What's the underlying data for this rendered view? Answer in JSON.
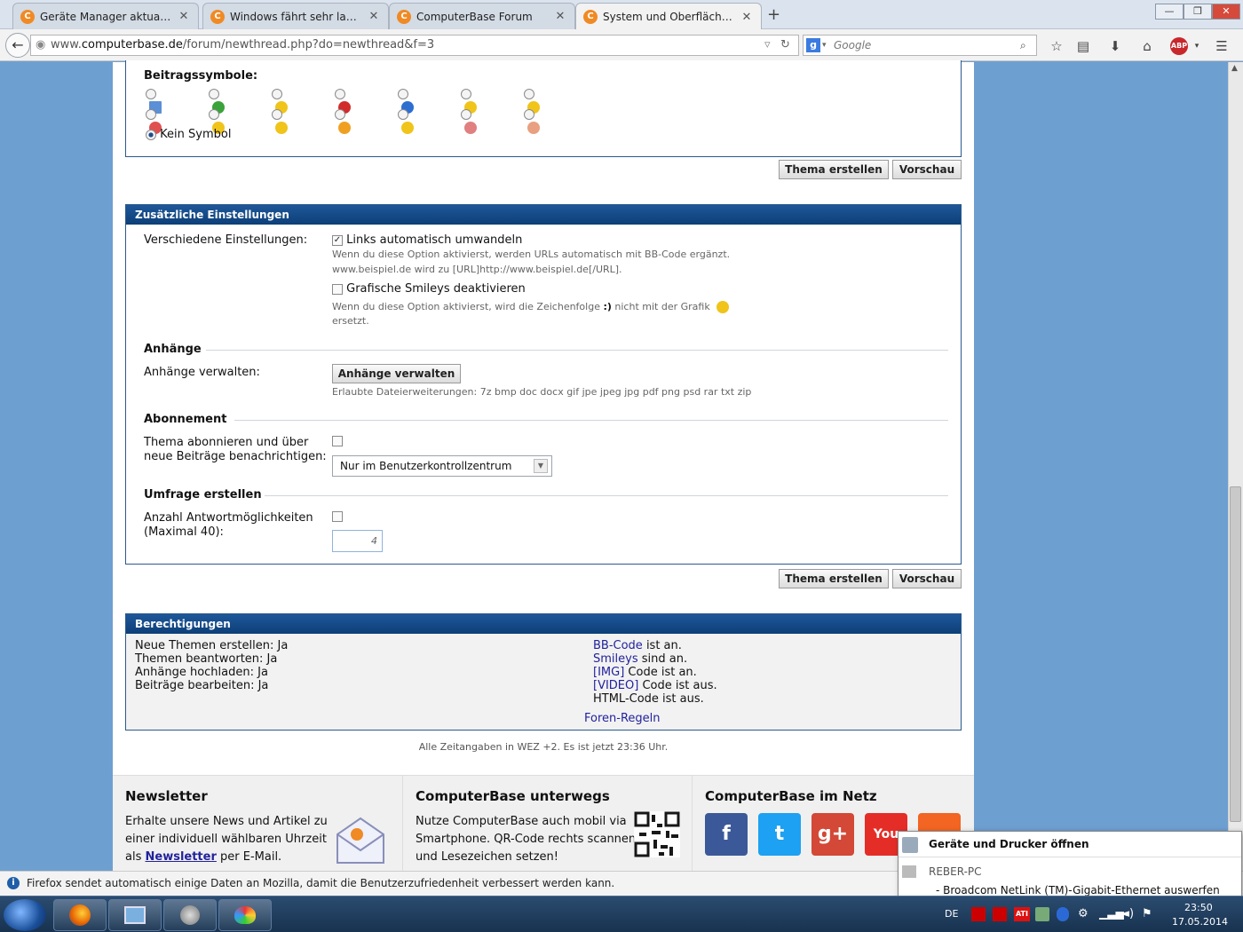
{
  "browser": {
    "tabs": [
      {
        "title": "Geräte Manager aktualisier..."
      },
      {
        "title": "Windows fährt sehr langsa..."
      },
      {
        "title": "ComputerBase Forum"
      },
      {
        "title": "System und Oberfläche - N..."
      }
    ],
    "url_prefix": "www.",
    "url_domain": "computerbase.de",
    "url_path": "/forum/newthread.php?do=newthread&f=3",
    "search_placeholder": "Google",
    "new_tab": "+",
    "window_buttons": {
      "minimize": "—",
      "restore": "❐",
      "close": "✕"
    }
  },
  "post_icons": {
    "heading": "Beitragssymbole:",
    "row1": [
      {
        "icon": "document-icon",
        "color": "#5b8fd6"
      },
      {
        "icon": "arrow-icon",
        "color": "#3aa33a"
      },
      {
        "icon": "lightbulb-icon",
        "color": "#f0c419"
      },
      {
        "icon": "exclamation-icon",
        "color": "#d22b2b"
      },
      {
        "icon": "question-icon",
        "color": "#2c6fd1"
      },
      {
        "icon": "cool-smiley-icon",
        "color": "#f0c419"
      },
      {
        "icon": "smiley-icon",
        "color": "#f0c419"
      }
    ],
    "row2": [
      {
        "icon": "angry-smiley-icon",
        "color": "#e05050"
      },
      {
        "icon": "sad-smiley-icon",
        "color": "#f0c419"
      },
      {
        "icon": "grin-smiley-icon",
        "color": "#f0c419"
      },
      {
        "icon": "happy-smiley-icon",
        "color": "#f0a020"
      },
      {
        "icon": "laugh-smiley-icon",
        "color": "#f0c419"
      },
      {
        "icon": "thumbs-down-icon",
        "color": "#e08080"
      },
      {
        "icon": "thumbs-up-icon",
        "color": "#e8a080"
      }
    ],
    "no_symbol": "Kein Symbol"
  },
  "buttons": {
    "create": "Thema erstellen",
    "preview": "Vorschau"
  },
  "additional": {
    "title": "Zusätzliche Einstellungen",
    "misc_label": "Verschiedene Einstellungen:",
    "autolink_label": "Links automatisch umwandeln",
    "autolink_hint1": "Wenn du diese Option aktivierst, werden URLs automatisch mit BB-Code ergänzt.",
    "autolink_hint2": "www.beispiel.de wird zu [URL]http://www.beispiel.de[/URL].",
    "smilies_label": "Grafische Smileys deaktivieren",
    "smilies_hint1": "Wenn du diese Option aktivierst, wird die Zeichenfolge",
    "smilies_hint_code": ":)",
    "smilies_hint2": "nicht mit der Grafik",
    "smilies_hint3": "ersetzt.",
    "attach_section": "Anhänge",
    "attach_label": "Anhänge verwalten:",
    "attach_button": "Anhänge verwalten",
    "attach_hint": "Erlaubte Dateierweiterungen: 7z bmp doc docx gif jpe jpeg jpg pdf png psd rar txt zip",
    "subscribe_section": "Abonnement",
    "subscribe_label1": "Thema abonnieren und über",
    "subscribe_label2": "neue Beiträge benachrichtigen:",
    "subscribe_select": "Nur im Benutzerkontrollzentrum",
    "poll_section": "Umfrage erstellen",
    "poll_label1": "Anzahl Antwortmöglichkeiten",
    "poll_label2": "(Maximal 40):",
    "poll_value": "4"
  },
  "permissions": {
    "title": "Berechtigungen",
    "left": [
      "Neue Themen erstellen: Ja",
      "Themen beantworten: Ja",
      "Anhänge hochladen: Ja",
      "Beiträge bearbeiten: Ja"
    ],
    "bbcode_link": "BB-Code",
    "bbcode_text": " ist an.",
    "smileys_link": "Smileys",
    "smileys_text": " sind an.",
    "img_link": "[IMG]",
    "img_text": " Code ist an.",
    "video_link": "[VIDEO]",
    "video_text": " Code ist aus.",
    "html_text": "HTML-Code ist aus.",
    "rules_link": "Foren-Regeln"
  },
  "timezone_note": "Alle Zeitangaben in WEZ +2. Es ist jetzt 23:36 Uhr.",
  "footer": {
    "newsletter_title": "Newsletter",
    "newsletter_line1": "Erhalte unsere News und Artikel zu",
    "newsletter_line2": "einer individuell wählbaren Uhrzeit",
    "newsletter_pre": "als",
    "newsletter_link": "Newsletter",
    "newsletter_post": "per E-Mail.",
    "mobile_title": "ComputerBase unterwegs",
    "mobile_line1": "Nutze ComputerBase auch mobil via",
    "mobile_line2": "Smartphone. QR-Code rechts scannen",
    "mobile_line3": "und Lesezeichen setzen!",
    "net_title": "ComputerBase im Netz",
    "social": [
      {
        "name": "facebook-icon",
        "glyph": "f",
        "color": "#3b5998"
      },
      {
        "name": "twitter-icon",
        "glyph": "t",
        "color": "#1da1f2"
      },
      {
        "name": "google-plus-icon",
        "glyph": "g+",
        "color": "#d34836"
      },
      {
        "name": "youtube-icon",
        "glyph": "You",
        "color": "#e52d27"
      },
      {
        "name": "rss-icon",
        "glyph": "",
        "color": "#f26522"
      }
    ]
  },
  "notification": "Firefox sendet automatisch einige Daten an Mozilla, damit die Benutzerzufriedenheit verbessert werden kann.",
  "popup": {
    "title": "Geräte und Drucker öffnen",
    "pc": "REBER-PC",
    "eject": "-   Broadcom NetLink (TM)-Gigabit-Ethernet auswerfen"
  },
  "taskbar": {
    "lang": "DE",
    "time": "23:50",
    "date": "17.05.2014"
  }
}
